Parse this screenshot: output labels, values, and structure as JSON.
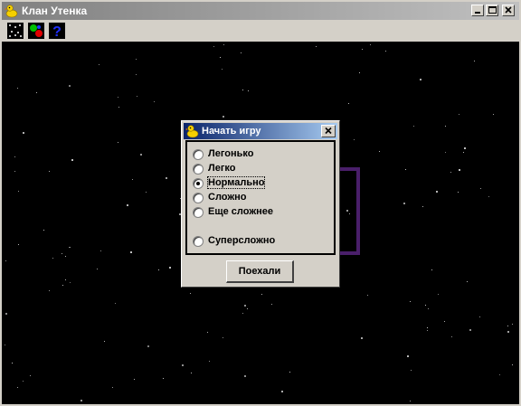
{
  "window": {
    "title": "Клан Утенка",
    "icon": "duck-icon",
    "controls": [
      "minimize-icon",
      "maximize-icon",
      "close-icon"
    ]
  },
  "toolbar": {
    "tools": [
      {
        "name": "starfield-tool",
        "icon": "starfield-icon"
      },
      {
        "name": "colors-tool",
        "icon": "color-dots-icon"
      },
      {
        "name": "help-tool",
        "icon": "question-icon"
      }
    ]
  },
  "dialog": {
    "title": "Начать игру",
    "icon": "duck-icon",
    "difficulty_options": [
      {
        "label": "Легонько",
        "selected": false
      },
      {
        "label": "Легко",
        "selected": false
      },
      {
        "label": "Нормально",
        "selected": true
      },
      {
        "label": "Сложно",
        "selected": false
      },
      {
        "label": "Еще сложнее",
        "selected": false
      },
      {
        "label": "Суперсложно",
        "selected": false
      }
    ],
    "start_button": "Поехали"
  },
  "colors": {
    "space": "#000000",
    "rect_outline": "#4a1f6a",
    "dialog_title_from": "#0a246a",
    "dialog_title_to": "#a6caf0"
  }
}
